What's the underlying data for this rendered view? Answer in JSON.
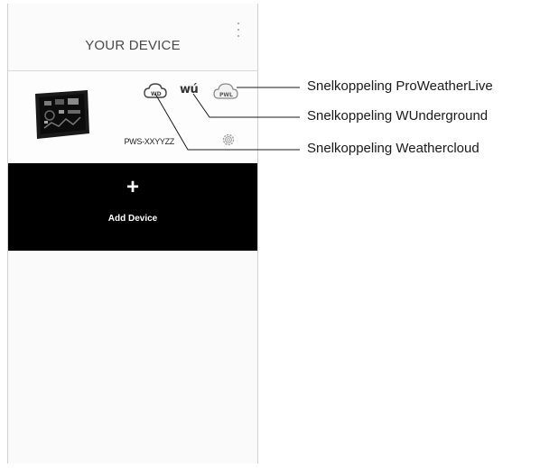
{
  "header": {
    "title": "YOUR DEVICE"
  },
  "device": {
    "name": "PWS-XXYYZZ"
  },
  "icons": {
    "weathercloud": "cloud-icon",
    "wunderground": "wu-icon",
    "wunderground_text": "wú",
    "proweatherlive": "pwl-icon",
    "proweatherlive_text": "PWL",
    "settings": "gear-icon",
    "menu": "kebab-menu-icon"
  },
  "add_device": {
    "plus": "+",
    "label": "Add Device"
  },
  "callouts": [
    {
      "label": "Snelkoppeling ProWeatherLive"
    },
    {
      "label": "Snelkoppeling WUnderground"
    },
    {
      "label": "Snelkoppeling Weathercloud"
    }
  ],
  "colors": {
    "add_device_bg": "#000000",
    "panel_bg": "#fbfbfb"
  }
}
